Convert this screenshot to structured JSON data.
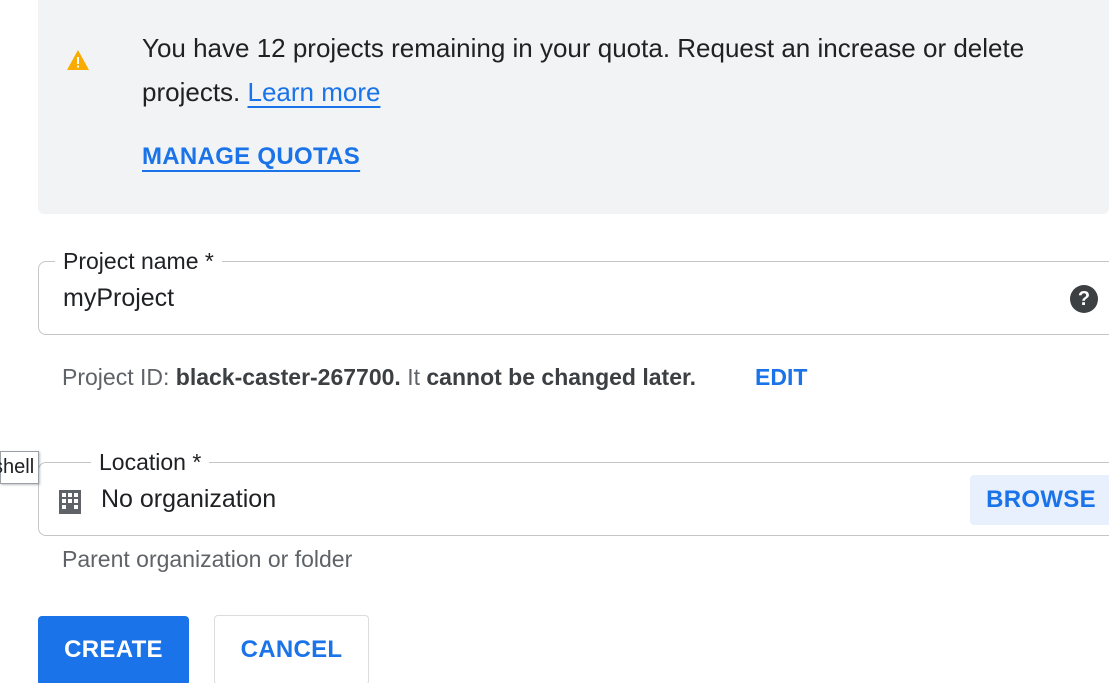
{
  "banner": {
    "icon": "warning-icon",
    "message": "You have 12 projects remaining in your quota. Request an increase or delete projects.",
    "learn_more": "Learn more",
    "manage_quotas": "MANAGE QUOTAS",
    "warning_color": "#f9ab00"
  },
  "project_name": {
    "label": "Project name *",
    "value": "myProject",
    "help_icon": "help-circle-icon"
  },
  "project_id": {
    "prefix": "Project ID:",
    "id": "black-caster-267700.",
    "mid": "It",
    "suffix": "cannot be changed later.",
    "edit": "EDIT"
  },
  "tooltip": {
    "text": "shell"
  },
  "location": {
    "label": "Location *",
    "icon": "organization-icon",
    "value": "No organization",
    "browse": "BROWSE",
    "helper": "Parent organization or folder"
  },
  "actions": {
    "create": "CREATE",
    "cancel": "CANCEL"
  },
  "colors": {
    "accent": "#1a73e8",
    "banner_bg": "#f1f3f4"
  }
}
